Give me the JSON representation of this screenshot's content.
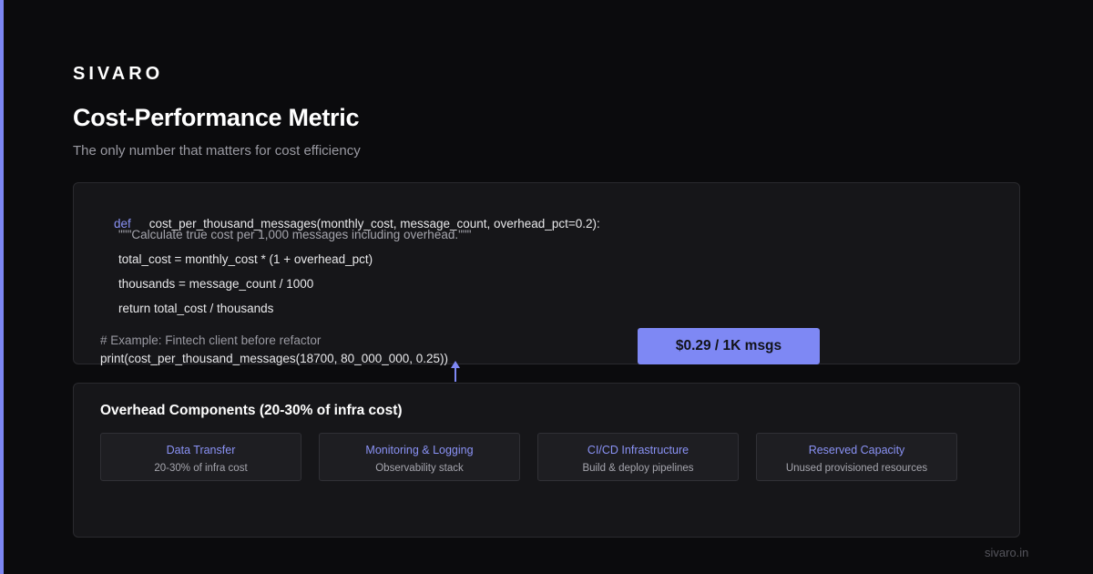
{
  "brand": "SIVARO",
  "title": "Cost-Performance Metric",
  "subtitle": "The only number that matters for cost efficiency",
  "code": {
    "def_keyword": "def",
    "signature": "cost_per_thousand_messages(monthly_cost, message_count, overhead_pct=0.2):",
    "docstring": "\"\"\"Calculate true cost per 1,000 messages including overhead.\"\"\"",
    "line_total": "total_cost = monthly_cost * (1 + overhead_pct)",
    "line_thousands": "thousands = message_count / 1000",
    "line_return": "return total_cost / thousands",
    "comment": "# Example: Fintech client before refactor",
    "print_call": "print(cost_per_thousand_messages(18700, 80_000_000, 0.25))"
  },
  "result": "$0.29 / 1K msgs",
  "overhead": {
    "title": "Overhead Components (20-30% of infra cost)",
    "cards": [
      {
        "title": "Data Transfer",
        "desc": "20-30% of infra cost"
      },
      {
        "title": "Monitoring & Logging",
        "desc": "Observability stack"
      },
      {
        "title": "CI/CD Infrastructure",
        "desc": "Build & deploy pipelines"
      },
      {
        "title": "Reserved Capacity",
        "desc": "Unused provisioned resources"
      }
    ]
  },
  "footer": "sivaro.in",
  "colors": {
    "accent": "#7e88f4",
    "background": "#0b0b0d",
    "panel": "#161619"
  }
}
